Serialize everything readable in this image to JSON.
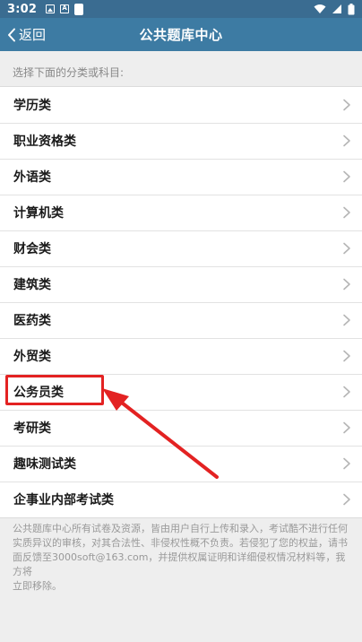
{
  "status_bar": {
    "time": "3:02",
    "left_icons": [
      "image-icon",
      "a-letter-icon",
      "notification-icon"
    ],
    "right_icons": [
      "wifi-icon",
      "signal-icon",
      "battery-icon"
    ]
  },
  "nav": {
    "back_label": "返回",
    "title": "公共题库中心"
  },
  "hint": "选择下面的分类或科目:",
  "categories": [
    "学历类",
    "职业资格类",
    "外语类",
    "计算机类",
    "财会类",
    "建筑类",
    "医药类",
    "外贸类",
    "公务员类",
    "考研类",
    "趣味测试类",
    "企事业内部考试类"
  ],
  "footer": {
    "line1": "公共题库中心所有试卷及资源，皆由用户自行上传和录入，考试酷不进行任何",
    "line2": "实质异议的审核，对其合法性、非侵权性概不负责。若侵犯了您的权益，请书",
    "line3": "面反馈至3000soft@163.com，并提供权属证明和详细侵权情况材料等，我方将",
    "line4": "立即移除。"
  },
  "colors": {
    "nav_bg": "#3d7ba3",
    "status_bg": "#3a6c91",
    "annotation": "#e32222"
  }
}
